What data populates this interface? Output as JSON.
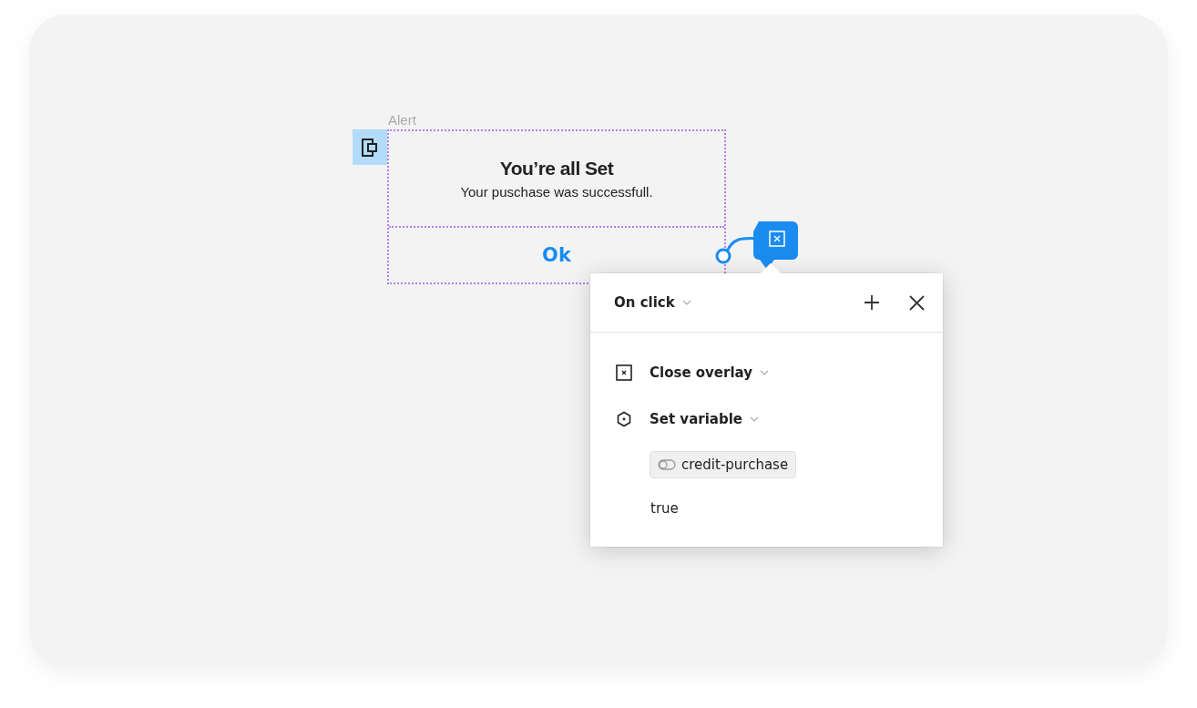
{
  "frame": {
    "label": "Alert",
    "title": "You’re all Set",
    "message": "Your puschase was successfull.",
    "button": "Ok"
  },
  "interaction": {
    "trigger": "On click",
    "actions": [
      {
        "kind": "close_overlay",
        "label": "Close overlay"
      },
      {
        "kind": "set_variable",
        "label": "Set variable",
        "variable": "credit-purchase",
        "value": "true"
      }
    ]
  }
}
